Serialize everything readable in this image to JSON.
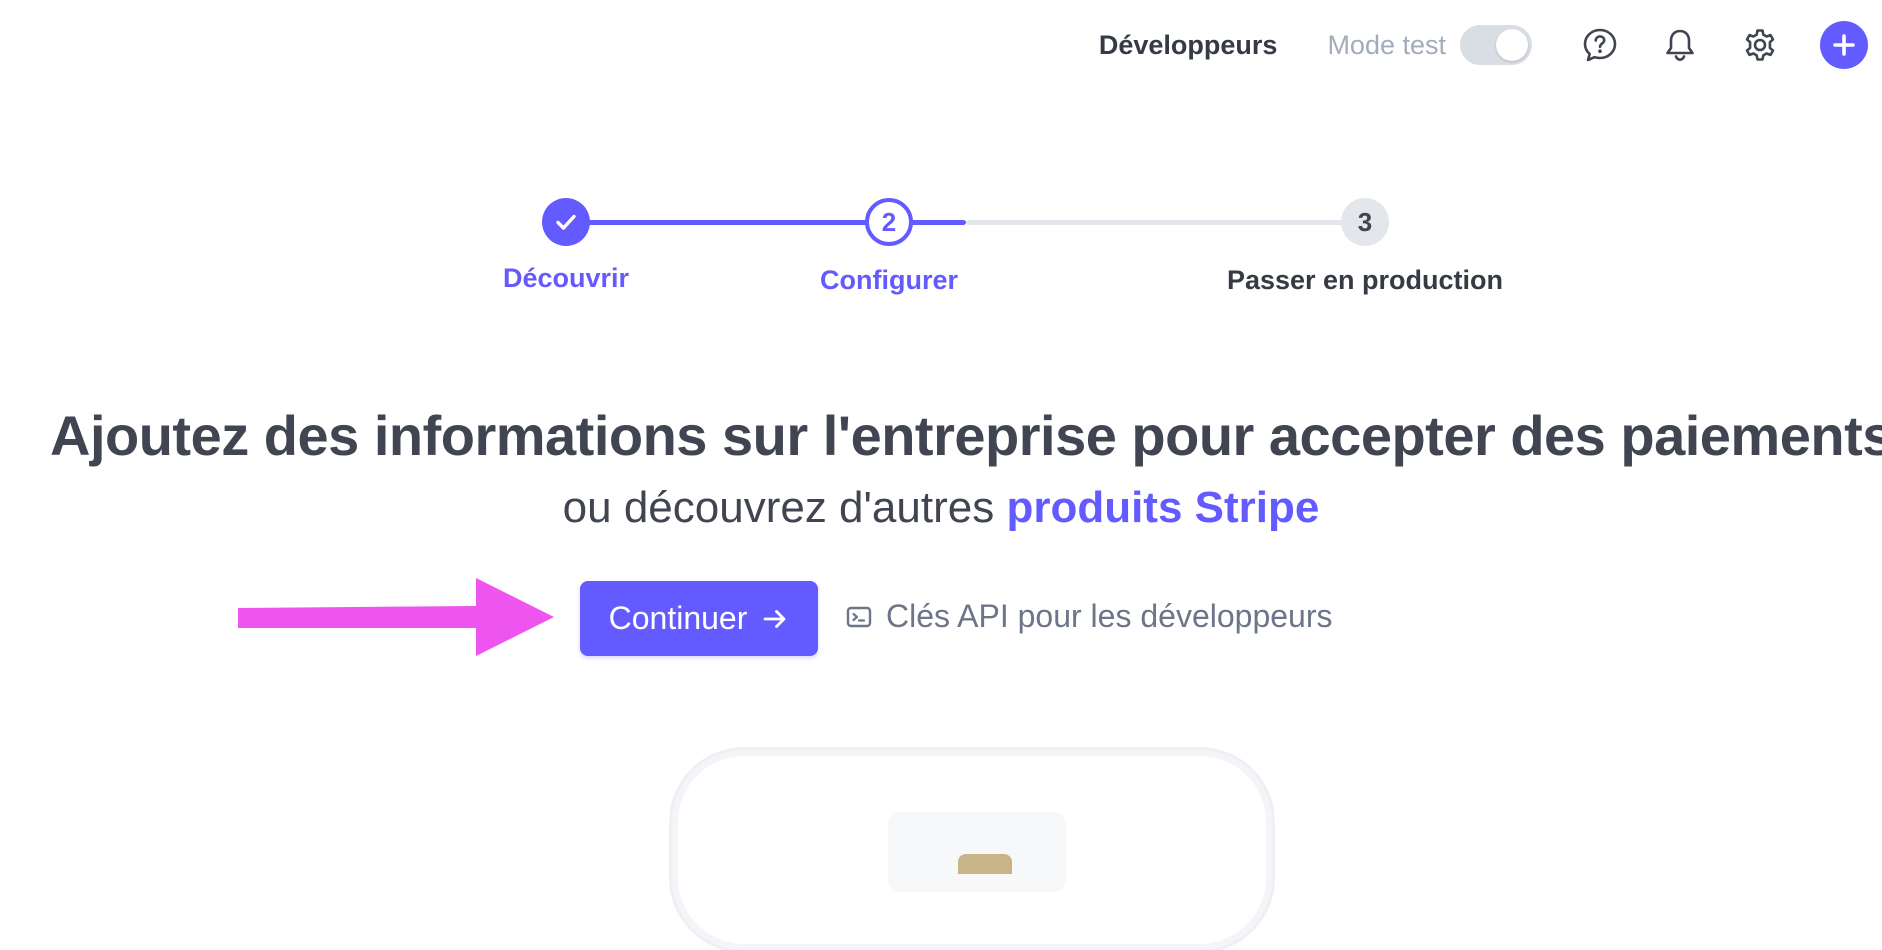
{
  "topbar": {
    "developers_label": "Développeurs",
    "test_mode_label": "Mode test",
    "test_mode_enabled": false,
    "icons": [
      "help-icon",
      "bell-icon",
      "gear-icon",
      "plus-icon"
    ]
  },
  "stepper": {
    "steps": [
      {
        "number": "",
        "label": "Découvrir",
        "state": "complete"
      },
      {
        "number": "2",
        "label": "Configurer",
        "state": "current"
      },
      {
        "number": "3",
        "label": "Passer en production",
        "state": "upcoming"
      }
    ]
  },
  "main": {
    "headline": "Ajoutez des informations sur l'entreprise pour accepter des paiements",
    "subline_prefix": "ou découvrez d'autres ",
    "subline_link": "produits Stripe",
    "continue_label": "Continuer",
    "api_keys_label": "Clés API pour les développeurs"
  },
  "colors": {
    "accent": "#635bff",
    "text": "#414552",
    "muted": "#6c7688",
    "annotation": "#ee55ee"
  }
}
